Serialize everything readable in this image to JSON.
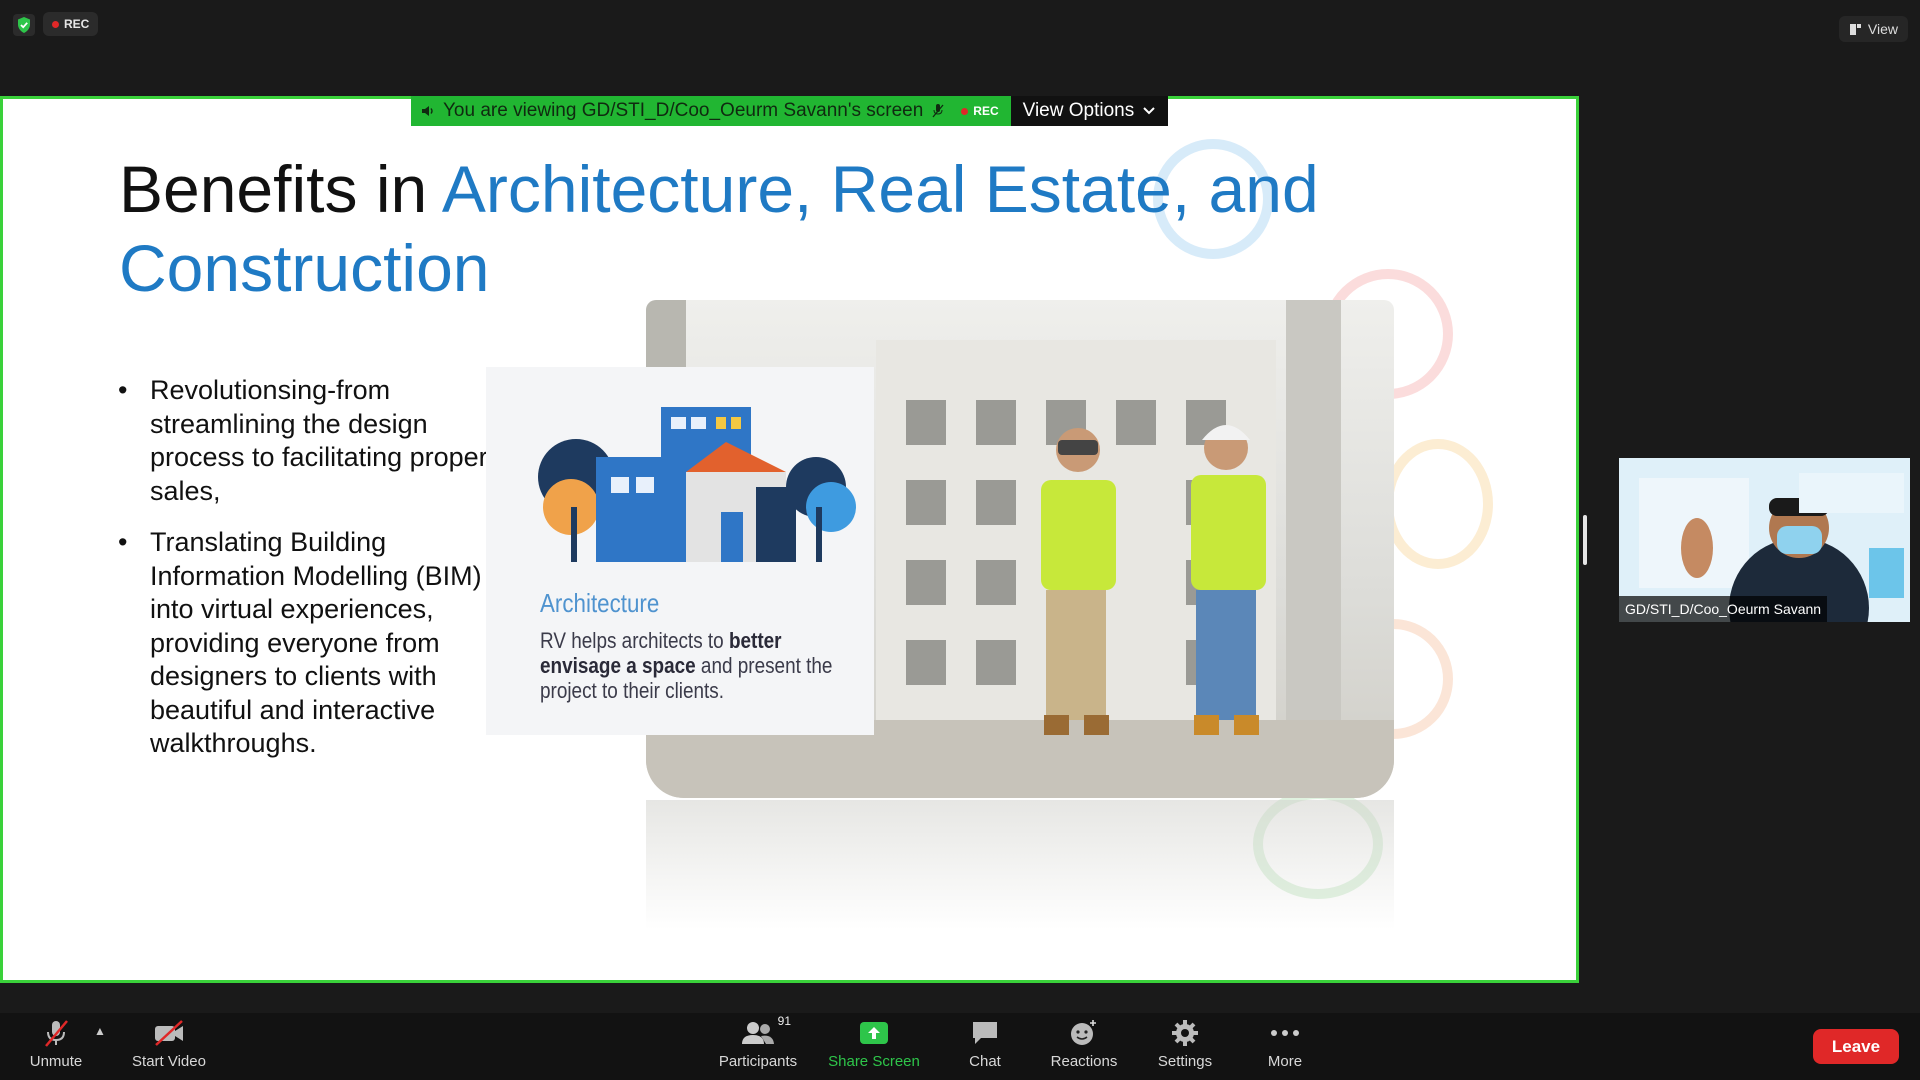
{
  "top_bar": {
    "rec_label": "REC",
    "view_label": "View"
  },
  "share": {
    "viewing_text": "You are viewing GD/STI_D/Coo_Oeurm Savann's screen",
    "rec_label": "REC",
    "view_options_label": "View Options"
  },
  "slide": {
    "title_black": "Benefits in ",
    "title_blue": "Architecture, Real Estate, and Construction",
    "bullets": [
      "Revolutionsing-from streamlining the design process to facilitating property sales,",
      "Translating Building Information Modelling (BIM) into virtual experiences, providing everyone from designers to clients with beautiful and interactive walkthroughs."
    ],
    "card_title": "Architecture",
    "card_text_pre": "RV helps architects to ",
    "card_text_bold": "better envisage a space",
    "card_text_post": " and present the project to their clients."
  },
  "participant": {
    "name": "GD/STI_D/Coo_Oeurm Savann"
  },
  "toolbar": {
    "unmute_label": "Unmute",
    "start_video_label": "Start Video",
    "participants_label": "Participants",
    "participants_count": "91",
    "share_screen_label": "Share Screen",
    "chat_label": "Chat",
    "reactions_label": "Reactions",
    "settings_label": "Settings",
    "more_label": "More",
    "leave_label": "Leave"
  },
  "colors": {
    "share_border": "#3ad13a",
    "banner_green": "#21b632",
    "title_blue": "#1f7ac4",
    "leave_red": "#e02828",
    "share_screen_green": "#2ec54a"
  }
}
